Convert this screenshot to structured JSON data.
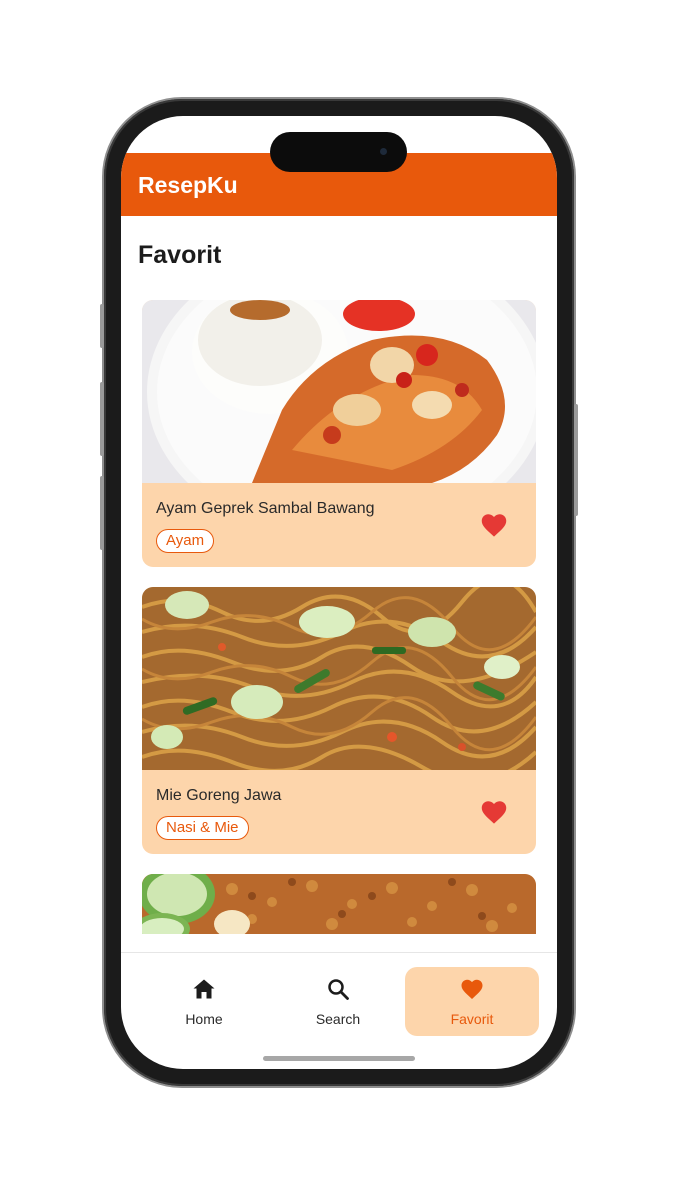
{
  "app": {
    "title": "ResepKu"
  },
  "page": {
    "title": "Favorit"
  },
  "recipes": [
    {
      "name": "Ayam Geprek Sambal Bawang",
      "category": "Ayam",
      "favorite": true,
      "image": "fried-chicken-rice-photo"
    },
    {
      "name": "Mie Goreng Jawa",
      "category": "Nasi & Mie",
      "favorite": true,
      "image": "fried-noodles-photo"
    },
    {
      "image": "shredded-beef-serundeng-photo"
    }
  ],
  "nav": {
    "home_label": "Home",
    "search_label": "Search",
    "favorit_label": "Favorit",
    "active": "favorit"
  },
  "colors": {
    "primary": "#e8590c",
    "card_bg": "#fdd5ab",
    "heart": "#e53935",
    "text": "#1c1c1c"
  },
  "icons": [
    "home-icon",
    "search-icon",
    "heart-icon"
  ]
}
